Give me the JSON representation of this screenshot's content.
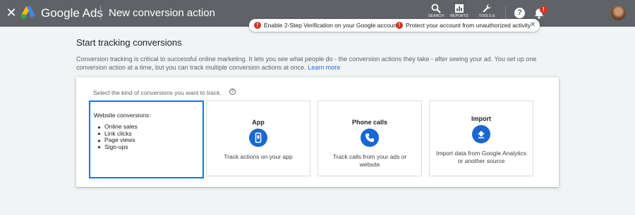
{
  "header": {
    "close_icon": "close-icon",
    "brand": "Google Ads",
    "page_title": "New conversion action",
    "tools": [
      {
        "label": "SEARCH",
        "icon": "search-icon"
      },
      {
        "label": "REPORTS",
        "icon": "reports-icon"
      },
      {
        "label": "TOOLS &",
        "icon": "wrench-icon"
      }
    ],
    "notification_badge": "!",
    "help_icon": "?"
  },
  "notification": {
    "items": [
      "Enable 2-Step Verification on your Google account",
      "Protect your account from unauthorized activity"
    ],
    "warn_glyph": "!",
    "close_glyph": "✕"
  },
  "content": {
    "heading": "Start tracking conversions",
    "description": "Conversion tracking is critical to successful online marketing. It lets you see what people do - the conversion actions they take - after seeing your ad. You set up one conversion action at a time, but you can track multiple conversion actions at once.",
    "learn_more": "Learn more",
    "prompt": "Select the kind of conversions you want to track.",
    "prompt_help": "?"
  },
  "options": {
    "website": {
      "title": "Website conversions:",
      "items": [
        "Online sales",
        "Link clicks",
        "Page views",
        "Sign-ups"
      ]
    },
    "app": {
      "title": "App",
      "description": "Track actions on your app",
      "icon": "phone-app-icon"
    },
    "phone": {
      "title": "Phone calls",
      "description": "Track calls from your ads or website",
      "icon": "phone-call-icon"
    },
    "import": {
      "title": "Import",
      "description": "Import data from Google Analytics or another source",
      "icon": "upload-icon"
    }
  },
  "colors": {
    "topbar": "#5f6368",
    "accent": "#1a73e8",
    "icon_circle": "#1967d2",
    "warning": "#d93025"
  }
}
